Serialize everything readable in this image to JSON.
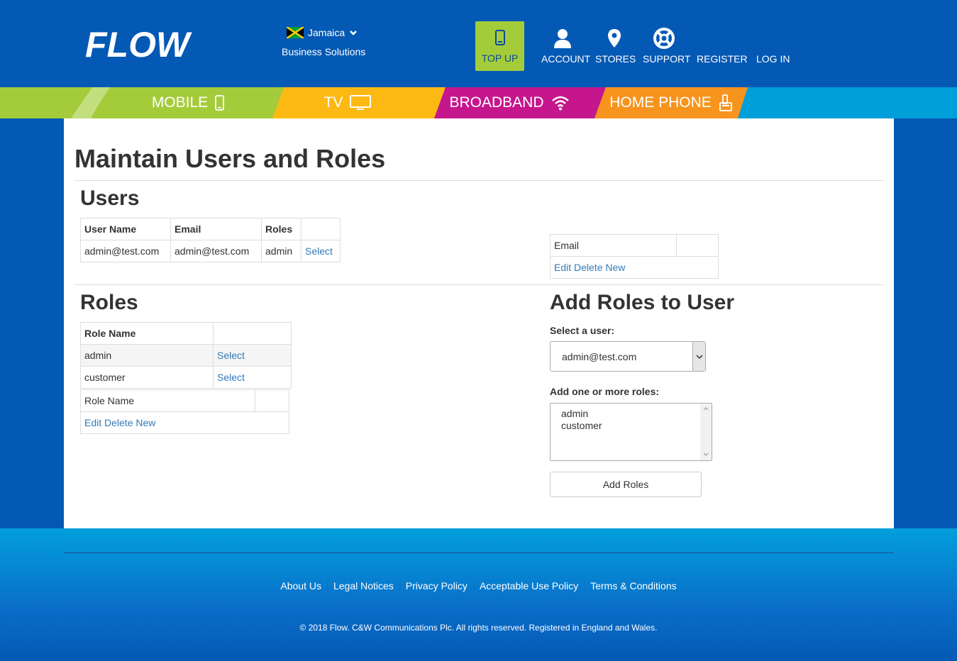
{
  "header": {
    "logo_text": "FLOW",
    "country": "Jamaica",
    "business": "Business Solutions",
    "topup": "TOP UP",
    "nav": [
      "ACCOUNT",
      "STORES",
      "SUPPORT",
      "REGISTER",
      "LOG IN"
    ]
  },
  "products": [
    "MOBILE",
    "TV",
    "BROADBAND",
    "HOME PHONE"
  ],
  "colors": {
    "brand_blue": "#0459b4",
    "mobile": "#a4cc3a",
    "tv": "#fdb913",
    "broadband": "#c6168d",
    "homephone": "#f7941d",
    "link": "#337ab7"
  },
  "page": {
    "title": "Maintain Users and Roles"
  },
  "users": {
    "heading": "Users",
    "columns": [
      "User Name",
      "Email",
      "Roles",
      ""
    ],
    "rows": [
      {
        "username": "admin@test.com",
        "email": "admin@test.com",
        "roles": "admin",
        "action": "Select"
      }
    ]
  },
  "email_panel": {
    "label": "Email",
    "actions": "Edit Delete New"
  },
  "roles": {
    "heading": "Roles",
    "column": "Role Name",
    "rows": [
      {
        "name": "admin",
        "action": "Select"
      },
      {
        "name": "customer",
        "action": "Select"
      }
    ],
    "form_label": "Role Name",
    "actions": "Edit Delete New"
  },
  "add_roles": {
    "heading": "Add Roles to User",
    "select_label": "Select a user:",
    "selected_user": "admin@test.com",
    "roles_label": "Add one or more roles:",
    "options": [
      "admin",
      "customer"
    ],
    "button": "Add Roles"
  },
  "footer": {
    "links": [
      "About Us",
      "Legal Notices",
      "Privacy Policy",
      "Acceptable Use Policy",
      "Terms & Conditions"
    ],
    "copyright": "© 2018 Flow. C&W Communications Plc. All rights reserved. Registered in England and Wales."
  }
}
